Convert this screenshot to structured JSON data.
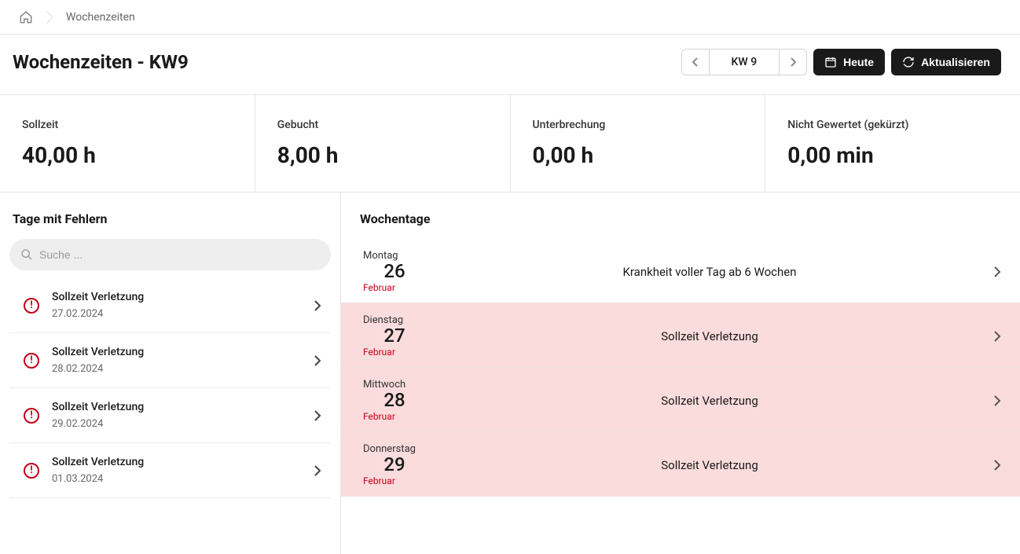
{
  "breadcrumb": {
    "home_icon": "home",
    "current": "Wochenzeiten"
  },
  "header": {
    "title": "Wochenzeiten - KW9",
    "week_label": "KW 9",
    "today_label": "Heute",
    "refresh_label": "Aktualisieren"
  },
  "stats": [
    {
      "label": "Sollzeit",
      "value": "40,00 h"
    },
    {
      "label": "Gebucht",
      "value": "8,00 h"
    },
    {
      "label": "Unterbrechung",
      "value": "0,00 h"
    },
    {
      "label": "Nicht Gewertet (gekürzt)",
      "value": "0,00 min"
    }
  ],
  "errors_section": {
    "title": "Tage mit Fehlern",
    "search_placeholder": "Suche ...",
    "items": [
      {
        "title": "Sollzeit Verletzung",
        "date": "27.02.2024"
      },
      {
        "title": "Sollzeit Verletzung",
        "date": "28.02.2024"
      },
      {
        "title": "Sollzeit Verletzung",
        "date": "29.02.2024"
      },
      {
        "title": "Sollzeit Verletzung",
        "date": "01.03.2024"
      }
    ]
  },
  "days_section": {
    "title": "Wochentage",
    "items": [
      {
        "weekday": "Montag",
        "day": "26",
        "month": "Februar",
        "message": "Krankheit voller Tag ab 6 Wochen",
        "error": false
      },
      {
        "weekday": "Dienstag",
        "day": "27",
        "month": "Februar",
        "message": "Sollzeit Verletzung",
        "error": true
      },
      {
        "weekday": "Mittwoch",
        "day": "28",
        "month": "Februar",
        "message": "Sollzeit Verletzung",
        "error": true
      },
      {
        "weekday": "Donnerstag",
        "day": "29",
        "month": "Februar",
        "message": "Sollzeit Verletzung",
        "error": true
      }
    ]
  }
}
